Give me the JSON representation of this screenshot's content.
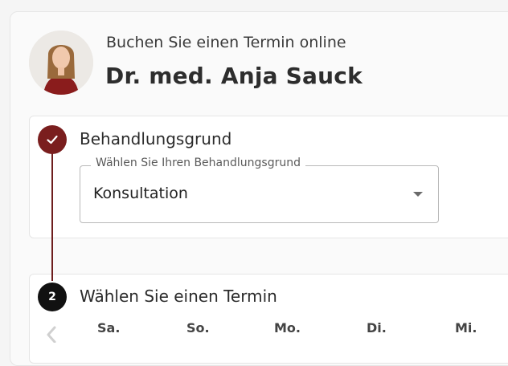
{
  "header": {
    "subtitle": "Buchen Sie einen Termin online",
    "doctor_name": "Dr. med. Anja Sauck"
  },
  "steps": [
    {
      "index": "1",
      "state": "completed",
      "icon": "check-icon",
      "title": "Behandlungsgrund",
      "field": {
        "label": "Wählen Sie Ihren Behandlungsgrund",
        "value": "Konsultation"
      }
    },
    {
      "index": "2",
      "state": "active",
      "title": "Wählen Sie einen Termin"
    }
  ],
  "calendar": {
    "days": [
      "Sa.",
      "So.",
      "Mo.",
      "Di.",
      "Mi."
    ]
  },
  "colors": {
    "accent": "#7a1e1e",
    "active_step": "#111111"
  }
}
